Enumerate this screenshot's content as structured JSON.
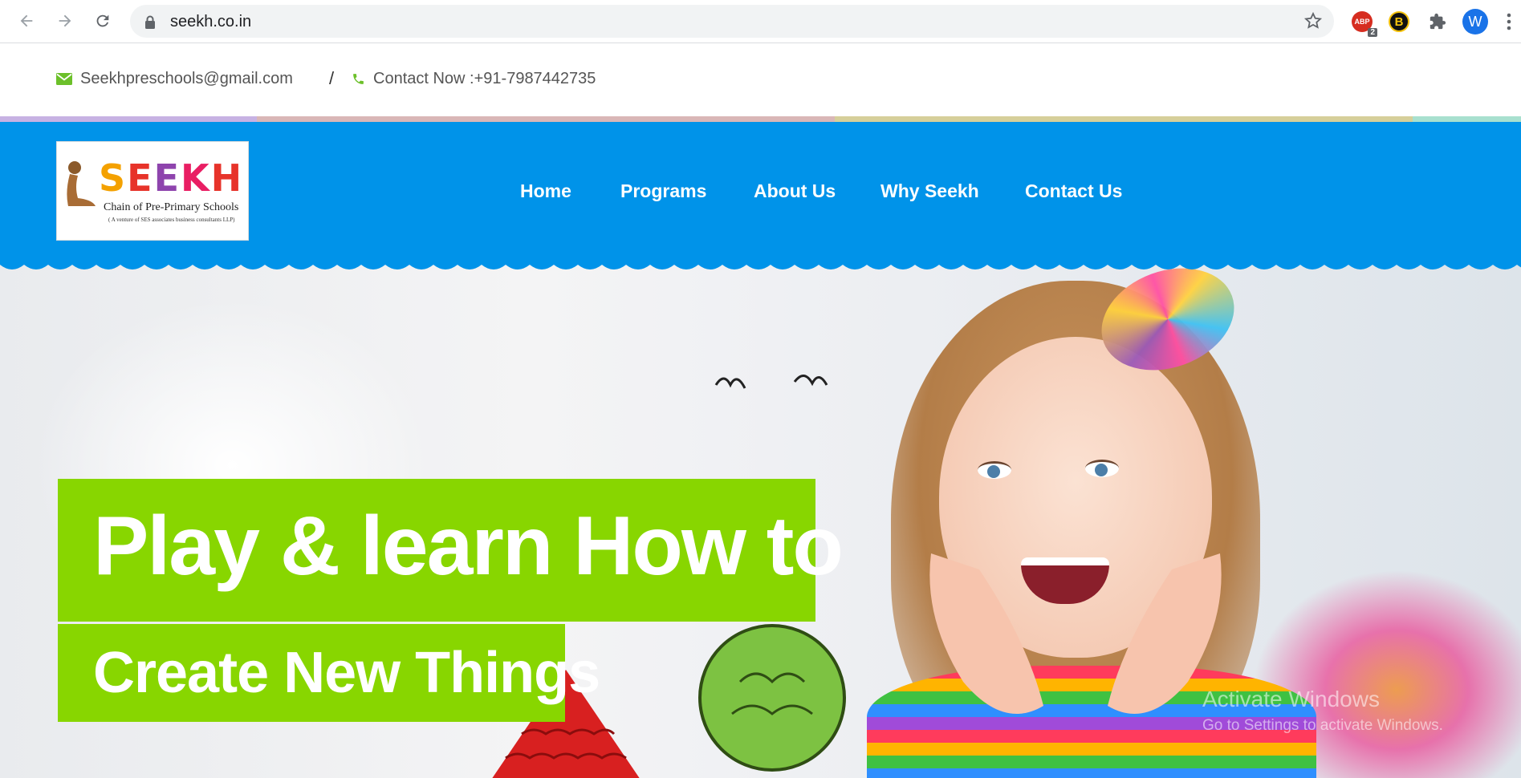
{
  "browser": {
    "url": "seekh.co.in",
    "abp_badge": "2",
    "abp_label": "ABP",
    "b_ext_label": "B",
    "profile_initial": "W"
  },
  "contact": {
    "email": "Seekhpreschools@gmail.com",
    "separator": "/",
    "phone": "Contact Now :+91-7987442735"
  },
  "logo": {
    "word": "SEEKH",
    "subtitle": "Chain of Pre-Primary Schools",
    "tagline": "( A venture of SES associates business consultants LLP)"
  },
  "nav": {
    "items": [
      "Home",
      "Programs",
      "About Us",
      "Why Seekh",
      "Contact Us"
    ]
  },
  "hero": {
    "headline_line1": "Play & learn How to",
    "headline_line2": "Create New Things"
  },
  "watermark": {
    "title": "Activate Windows",
    "subtitle": "Go to Settings to activate Windows."
  },
  "colors": {
    "header_blue": "#0093e9",
    "headline_green": "#88d600",
    "icon_green": "#6cc02a"
  },
  "icons": [
    "back-icon",
    "forward-icon",
    "reload-icon",
    "lock-icon",
    "star-icon",
    "puzzle-icon",
    "envelope-icon",
    "phone-icon",
    "menu-icon"
  ]
}
